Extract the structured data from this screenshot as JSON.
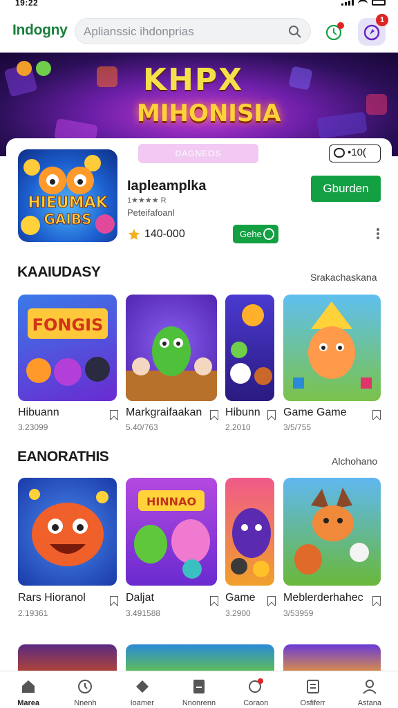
{
  "status_bar": {
    "time": "19:22"
  },
  "header": {
    "logo": "Indogny",
    "search_placeholder": "Aplianssic ihdonprias",
    "notification_badge": "1"
  },
  "banner": {
    "logo_line1": "KHPX",
    "logo_line2": "MIHONISIA"
  },
  "featured": {
    "tag": "DAGNEOS",
    "chat_label": "•10(",
    "image_title_line1": "HIEUMAK",
    "image_title_line2": "GAIBS",
    "title": "Iapleamplka",
    "rating": "1★★★★ R",
    "subtitle": "Peteifafoanl",
    "count": "140-000",
    "install_label": "Gburden",
    "tag_green": "Gehe"
  },
  "section1": {
    "title": "KAAIUDASY",
    "more": "Srakachaskana",
    "games": [
      {
        "name": "Hibuann",
        "meta": "3.23099",
        "art_text": "FONGIS"
      },
      {
        "name": "Markgraifaakan",
        "meta": "5.40/763"
      },
      {
        "name": "Hibunn",
        "meta": "2.2010"
      },
      {
        "name": "Game Game",
        "meta": "3/5/755"
      }
    ]
  },
  "section2": {
    "title": "EANORATHIS",
    "more": "Alchohano",
    "games": [
      {
        "name": "Rars Hioranol",
        "meta": "2.19361"
      },
      {
        "name": "Daljat",
        "meta": "3.491588",
        "art_text": "HINNAO"
      },
      {
        "name": "Game",
        "meta": "3.2900"
      },
      {
        "name": "Meblerderhahec",
        "meta": "3/53959"
      }
    ]
  },
  "nav": [
    {
      "label": "Marea",
      "icon": "home-icon"
    },
    {
      "label": "Nnenh",
      "icon": "explore-icon"
    },
    {
      "label": "Ioamer",
      "icon": "games-icon"
    },
    {
      "label": "Nnonrenn",
      "icon": "library-icon"
    },
    {
      "label": "Coraon",
      "icon": "chat-icon"
    },
    {
      "label": "Osfiferr",
      "icon": "list-icon"
    },
    {
      "label": "Astana",
      "icon": "profile-icon"
    }
  ],
  "colors": {
    "brand_green": "#13a043",
    "badge_red": "#e02424",
    "banner_purple": "#6c1fa8"
  }
}
